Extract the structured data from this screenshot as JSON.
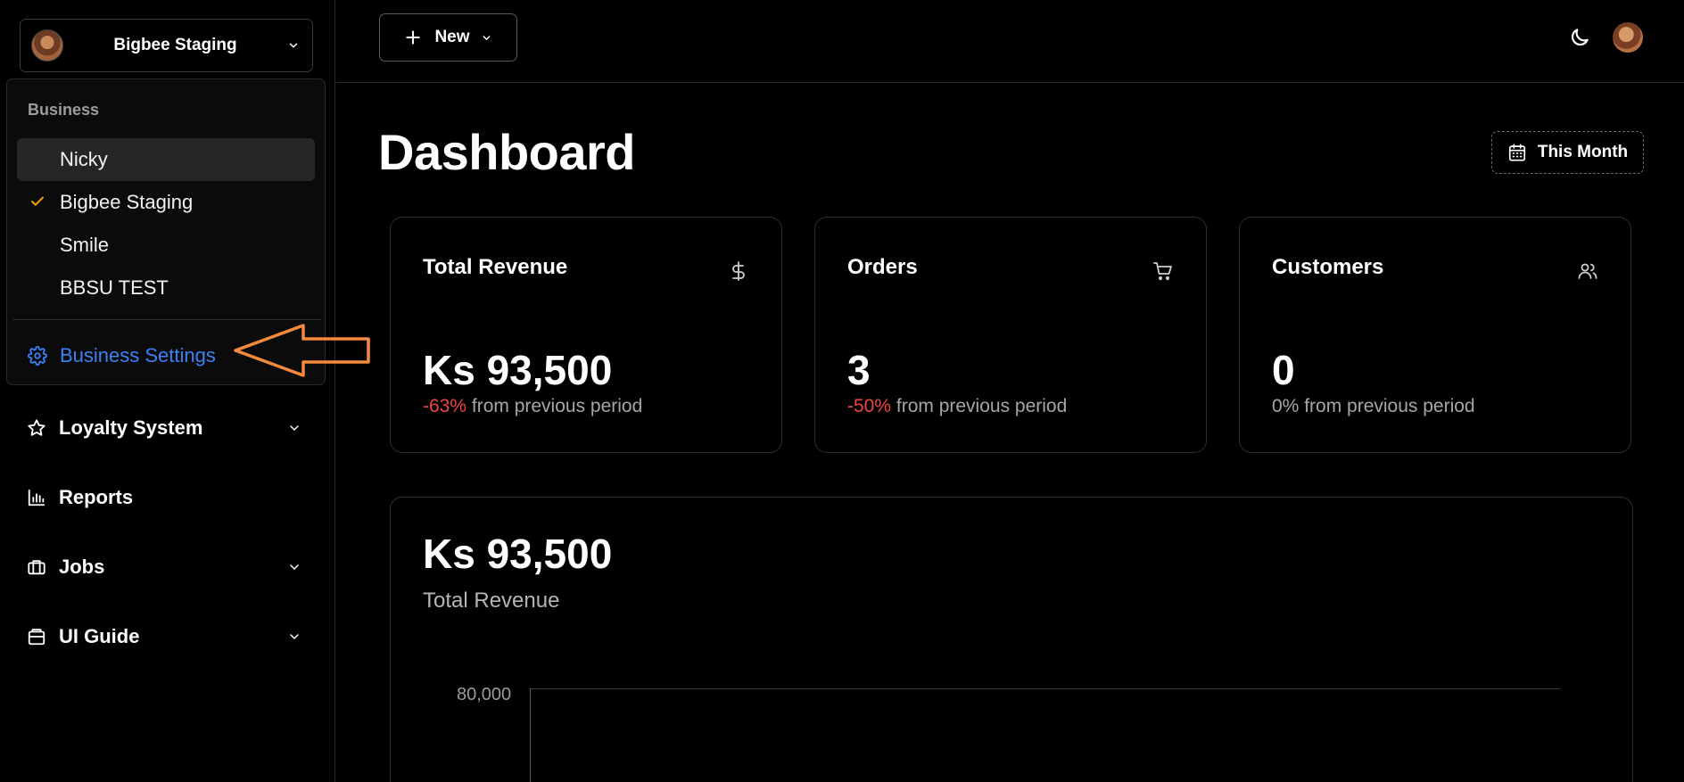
{
  "sidebar": {
    "business_switcher": {
      "name": "Bigbee Staging"
    },
    "nav": [
      {
        "label": "Loyalty System",
        "icon": "star-icon"
      },
      {
        "label": "Reports",
        "icon": "bar-chart-icon"
      },
      {
        "label": "Jobs",
        "icon": "briefcase-icon"
      },
      {
        "label": "UI Guide",
        "icon": "package-icon"
      }
    ]
  },
  "dropdown": {
    "heading": "Business",
    "items": [
      {
        "label": "Nicky",
        "selected": false,
        "hovered": true
      },
      {
        "label": "Bigbee Staging",
        "selected": true
      },
      {
        "label": "Smile",
        "selected": false
      },
      {
        "label": "BBSU TEST",
        "selected": false
      }
    ],
    "settings_label": "Business Settings"
  },
  "topbar": {
    "new_label": "New"
  },
  "main": {
    "title": "Dashboard",
    "period_label": "This Month",
    "cards": [
      {
        "title": "Total Revenue",
        "icon": "dollar-icon",
        "value": "Ks 93,500",
        "change": "-63%",
        "change_suffix": " from previous period"
      },
      {
        "title": "Orders",
        "icon": "cart-icon",
        "value": "3",
        "change": "-50%",
        "change_suffix": " from previous period"
      },
      {
        "title": "Customers",
        "icon": "users-icon",
        "value": "0",
        "change": "0%",
        "change_suffix": " from previous period"
      }
    ],
    "revenue_chart": {
      "value": "Ks 93,500",
      "label": "Total Revenue",
      "y_tick_top": "80,000"
    }
  },
  "colors": {
    "accent_blue": "#3b82f6",
    "negative_red": "#ef4444",
    "check_orange": "#f59e0b",
    "annotation_arrow": "#f58a3c"
  }
}
